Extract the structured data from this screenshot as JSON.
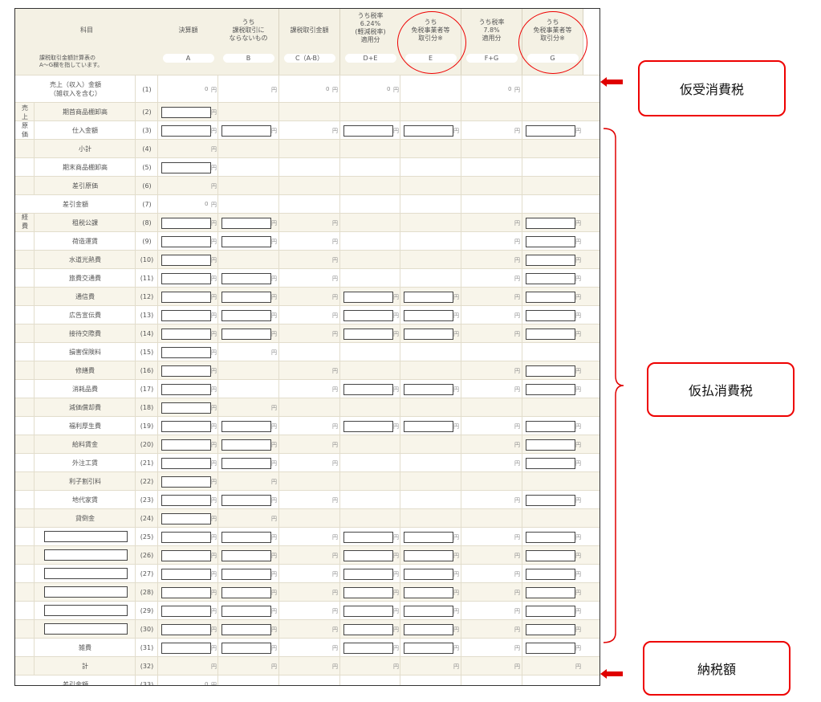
{
  "header": {
    "subject": "科目",
    "note": "課税取引金額計算表の\nA～G欄を指しています。",
    "cols": [
      {
        "id": "A",
        "text": "決算額",
        "letter": "A"
      },
      {
        "id": "B",
        "text": "うち\n課税取引に\nならないもの",
        "letter": "B"
      },
      {
        "id": "C",
        "text": "課税取引金額",
        "letter": "C（A-B）"
      },
      {
        "id": "D",
        "text": "うち税率\n6.24%\n(軽減税率)\n適用分",
        "letter": "D+E"
      },
      {
        "id": "E",
        "text": "うち\n免税事業者等\n取引分※",
        "letter": "E"
      },
      {
        "id": "F",
        "text": "うち税率\n7.8%\n適用分",
        "letter": "F+G"
      },
      {
        "id": "G",
        "text": "うち\n免税事業者等\n取引分※",
        "letter": "G"
      }
    ]
  },
  "sections": {
    "cost": "売\n上\n原\n価",
    "expenses": "経\n費"
  },
  "rows": [
    {
      "no": "(1)",
      "label": "売上（収入）金額\n（雑収入を含む）",
      "inputs": [],
      "yen": [
        "A",
        "B",
        "C",
        "D",
        "F"
      ],
      "zero": [
        "A",
        "C",
        "D",
        "F"
      ],
      "shade": false,
      "indent": false
    },
    {
      "no": "(2)",
      "label": "期首商品棚卸高",
      "inputs": [
        "A"
      ],
      "yen": [],
      "shade": true,
      "indent": true
    },
    {
      "no": "(3)",
      "label": "仕入金額",
      "inputs": [
        "A",
        "B",
        "D",
        "E",
        "G"
      ],
      "yen": [
        "C",
        "F"
      ],
      "shade": false,
      "indent": true
    },
    {
      "no": "(4)",
      "label": "小計",
      "inputs": [],
      "yen": [
        "A"
      ],
      "shade": true,
      "indent": true
    },
    {
      "no": "(5)",
      "label": "期末商品棚卸高",
      "inputs": [
        "A"
      ],
      "yen": [],
      "shade": false,
      "indent": true
    },
    {
      "no": "(6)",
      "label": "差引原価",
      "inputs": [],
      "yen": [
        "A"
      ],
      "shade": true,
      "indent": true
    },
    {
      "no": "(7)",
      "label": "差引金額",
      "inputs": [],
      "yen": [
        "A"
      ],
      "zero": [
        "A"
      ],
      "shade": false,
      "indent": false
    },
    {
      "no": "(8)",
      "label": "租税公課",
      "inputs": [
        "A",
        "B",
        "G"
      ],
      "yen": [
        "C",
        "F"
      ],
      "shade": true,
      "indent": true
    },
    {
      "no": "(9)",
      "label": "荷造運賃",
      "inputs": [
        "A",
        "B",
        "G"
      ],
      "yen": [
        "C",
        "F"
      ],
      "shade": false,
      "indent": true
    },
    {
      "no": "(10)",
      "label": "水道光熱費",
      "inputs": [
        "A",
        "G"
      ],
      "yen": [
        "C",
        "F"
      ],
      "shade": true,
      "indent": true
    },
    {
      "no": "(11)",
      "label": "旅費交通費",
      "inputs": [
        "A",
        "B",
        "G"
      ],
      "yen": [
        "C",
        "F"
      ],
      "shade": false,
      "indent": true
    },
    {
      "no": "(12)",
      "label": "通信費",
      "inputs": [
        "A",
        "B",
        "D",
        "E",
        "G"
      ],
      "yen": [
        "C",
        "F"
      ],
      "shade": true,
      "indent": true
    },
    {
      "no": "(13)",
      "label": "広告宣伝費",
      "inputs": [
        "A",
        "B",
        "D",
        "E",
        "G"
      ],
      "yen": [
        "C",
        "F"
      ],
      "shade": false,
      "indent": true
    },
    {
      "no": "(14)",
      "label": "接待交際費",
      "inputs": [
        "A",
        "B",
        "D",
        "E",
        "G"
      ],
      "yen": [
        "C",
        "F"
      ],
      "shade": true,
      "indent": true
    },
    {
      "no": "(15)",
      "label": "損害保険料",
      "inputs": [
        "A"
      ],
      "yen": [
        "B"
      ],
      "shade": false,
      "indent": true
    },
    {
      "no": "(16)",
      "label": "修繕費",
      "inputs": [
        "A",
        "G"
      ],
      "yen": [
        "C",
        "F"
      ],
      "shade": true,
      "indent": true
    },
    {
      "no": "(17)",
      "label": "消耗品費",
      "inputs": [
        "A",
        "D",
        "E",
        "G"
      ],
      "yen": [
        "C",
        "F"
      ],
      "shade": false,
      "indent": true
    },
    {
      "no": "(18)",
      "label": "減価償却費",
      "inputs": [
        "A"
      ],
      "yen": [
        "B"
      ],
      "shade": true,
      "indent": true
    },
    {
      "no": "(19)",
      "label": "福利厚生費",
      "inputs": [
        "A",
        "B",
        "D",
        "E",
        "G"
      ],
      "yen": [
        "C",
        "F"
      ],
      "shade": false,
      "indent": true
    },
    {
      "no": "(20)",
      "label": "給料賃金",
      "inputs": [
        "A",
        "B",
        "G"
      ],
      "yen": [
        "C",
        "F"
      ],
      "shade": true,
      "indent": true
    },
    {
      "no": "(21)",
      "label": "外注工賃",
      "inputs": [
        "A",
        "B",
        "G"
      ],
      "yen": [
        "C",
        "F"
      ],
      "shade": false,
      "indent": true
    },
    {
      "no": "(22)",
      "label": "利子割引料",
      "inputs": [
        "A"
      ],
      "yen": [
        "B"
      ],
      "shade": true,
      "indent": true
    },
    {
      "no": "(23)",
      "label": "地代家賃",
      "inputs": [
        "A",
        "B",
        "G"
      ],
      "yen": [
        "C",
        "F"
      ],
      "shade": false,
      "indent": true
    },
    {
      "no": "(24)",
      "label": "貸倒金",
      "inputs": [
        "A"
      ],
      "yen": [
        "B"
      ],
      "shade": true,
      "indent": true
    },
    {
      "no": "(25)",
      "label": "",
      "custom": true,
      "inputs": [
        "A",
        "B",
        "D",
        "E",
        "G"
      ],
      "yen": [
        "C",
        "F"
      ],
      "shade": false,
      "indent": true
    },
    {
      "no": "(26)",
      "label": "",
      "custom": true,
      "inputs": [
        "A",
        "B",
        "D",
        "E",
        "G"
      ],
      "yen": [
        "C",
        "F"
      ],
      "shade": true,
      "indent": true
    },
    {
      "no": "(27)",
      "label": "",
      "custom": true,
      "inputs": [
        "A",
        "B",
        "D",
        "E",
        "G"
      ],
      "yen": [
        "C",
        "F"
      ],
      "shade": false,
      "indent": true
    },
    {
      "no": "(28)",
      "label": "",
      "custom": true,
      "inputs": [
        "A",
        "B",
        "D",
        "E",
        "G"
      ],
      "yen": [
        "C",
        "F"
      ],
      "shade": true,
      "indent": true
    },
    {
      "no": "(29)",
      "label": "",
      "custom": true,
      "inputs": [
        "A",
        "B",
        "D",
        "E",
        "G"
      ],
      "yen": [
        "C",
        "F"
      ],
      "shade": false,
      "indent": true
    },
    {
      "no": "(30)",
      "label": "",
      "custom": true,
      "inputs": [
        "A",
        "B",
        "D",
        "E",
        "G"
      ],
      "yen": [
        "C",
        "F"
      ],
      "shade": true,
      "indent": true
    },
    {
      "no": "(31)",
      "label": "雑費",
      "inputs": [
        "A",
        "B",
        "D",
        "E",
        "G"
      ],
      "yen": [
        "C",
        "F"
      ],
      "shade": false,
      "indent": true
    },
    {
      "no": "(32)",
      "label": "計",
      "inputs": [],
      "yen": [
        "A",
        "B",
        "C",
        "D",
        "E",
        "F",
        "G"
      ],
      "shade": true,
      "indent": true
    },
    {
      "no": "(33)",
      "label": "差引金額",
      "inputs": [],
      "yen": [
        "A"
      ],
      "zero": [
        "A"
      ],
      "shade": false,
      "indent": false
    }
  ],
  "yen_symbol": "円",
  "zero_prefix": "0",
  "annotations": {
    "top": "仮受消費税",
    "middle": "仮払消費税",
    "bottom": "納税額"
  },
  "colors": {
    "accent": "#e00000",
    "header_bg": "#f4f1e4",
    "shade_bg": "#f8f5ea"
  }
}
